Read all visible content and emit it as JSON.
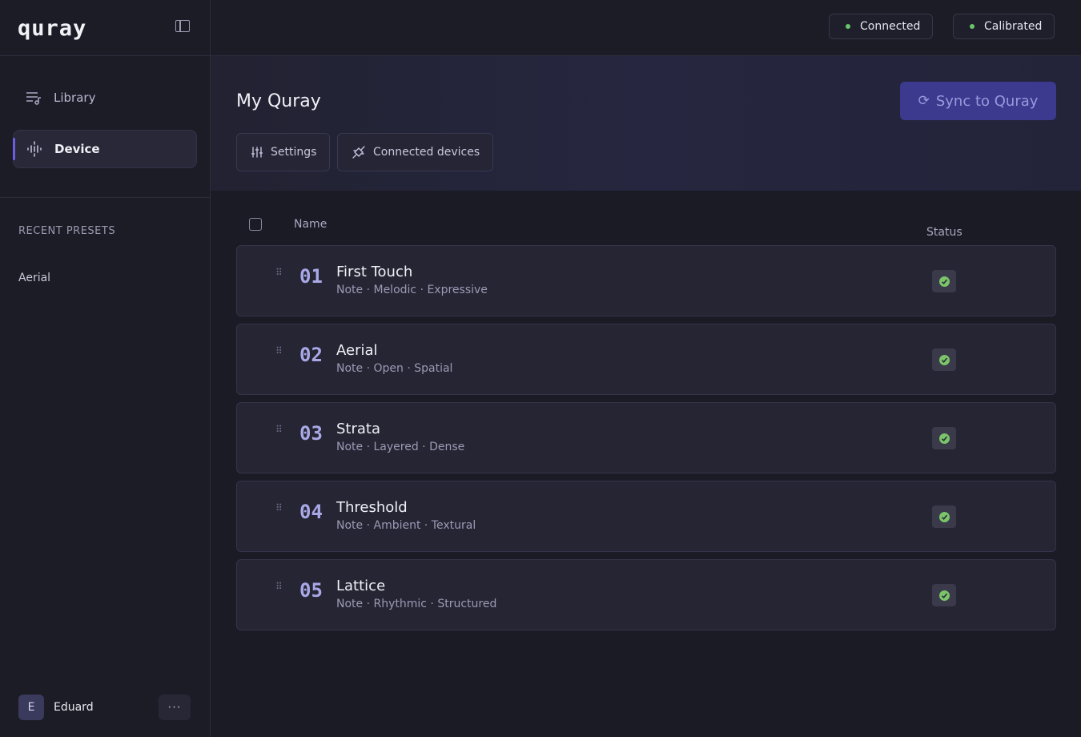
{
  "app": {
    "logo": "quray"
  },
  "topbar": {
    "connected": "Connected",
    "calibrated": "Calibrated"
  },
  "sidebar": {
    "items": [
      {
        "label": "Library",
        "icon": "library-music-icon"
      },
      {
        "label": "Device",
        "icon": "waveform-icon"
      }
    ],
    "recent_title": "RECENT PRESETS",
    "recent": [
      "Aerial"
    ],
    "user": {
      "initial": "E",
      "name": "Eduard",
      "more": "···"
    }
  },
  "header": {
    "title": "My Quray",
    "sync_label": "Sync to Quray",
    "tabs": [
      {
        "label": "Settings",
        "icon": "sliders-icon"
      },
      {
        "label": "Connected devices",
        "icon": "connection-icon"
      }
    ]
  },
  "table": {
    "col_name": "Name",
    "col_status": "Status",
    "rows": [
      {
        "num": "01",
        "title": "First Touch",
        "tags": "Note · Melodic · Expressive",
        "status": "synced"
      },
      {
        "num": "02",
        "title": "Aerial",
        "tags": "Note · Open · Spatial",
        "status": "synced"
      },
      {
        "num": "03",
        "title": "Strata",
        "tags": "Note · Layered · Dense",
        "status": "synced"
      },
      {
        "num": "04",
        "title": "Threshold",
        "tags": "Note · Ambient · Textural",
        "status": "synced"
      },
      {
        "num": "05",
        "title": "Lattice",
        "tags": "Note · Rhythmic · Structured",
        "status": "synced"
      }
    ]
  },
  "colors": {
    "accent": "#6a5fe0",
    "sync_button": "#3b3a8e",
    "status_green": "#6ac46a"
  }
}
